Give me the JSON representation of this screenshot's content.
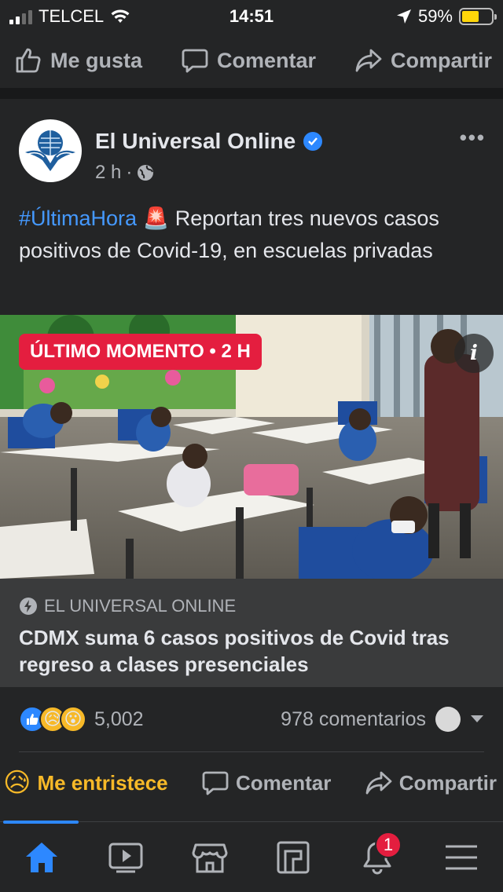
{
  "status_bar": {
    "carrier": "TELCEL",
    "time": "14:51",
    "battery": "59%",
    "battery_level": 0.59
  },
  "prev_post_actions": {
    "like": "Me gusta",
    "comment": "Comentar",
    "share": "Compartir"
  },
  "post": {
    "page_name": "El Universal Online",
    "time_ago": "2 h",
    "meta_sep": "·",
    "hashtag": "#ÚltimaHora",
    "siren_emoji": "🚨",
    "text": "Reportan tres nuevos casos positivos de Covid-19, en escuelas privadas",
    "image_badge": "ÚLTIMO MOMENTO • 2 H",
    "info_icon_label": "i",
    "link_source": "EL UNIVERSAL ONLINE",
    "link_title": "CDMX suma 6 casos positivos de Covid tras regreso a clases presenciales",
    "reaction_count": "5,002",
    "comments_count": "978 comentarios",
    "actions": {
      "reacted": "Me entristece",
      "comment": "Comentar",
      "share": "Compartir"
    }
  },
  "tabbar": {
    "notification_count": "1"
  },
  "colors": {
    "background": "#18191a",
    "card": "#242526",
    "link_box": "#3a3b3c",
    "accent": "#2d88ff",
    "badge_red": "#e41e3f",
    "sad_yellow": "#f7b928"
  }
}
